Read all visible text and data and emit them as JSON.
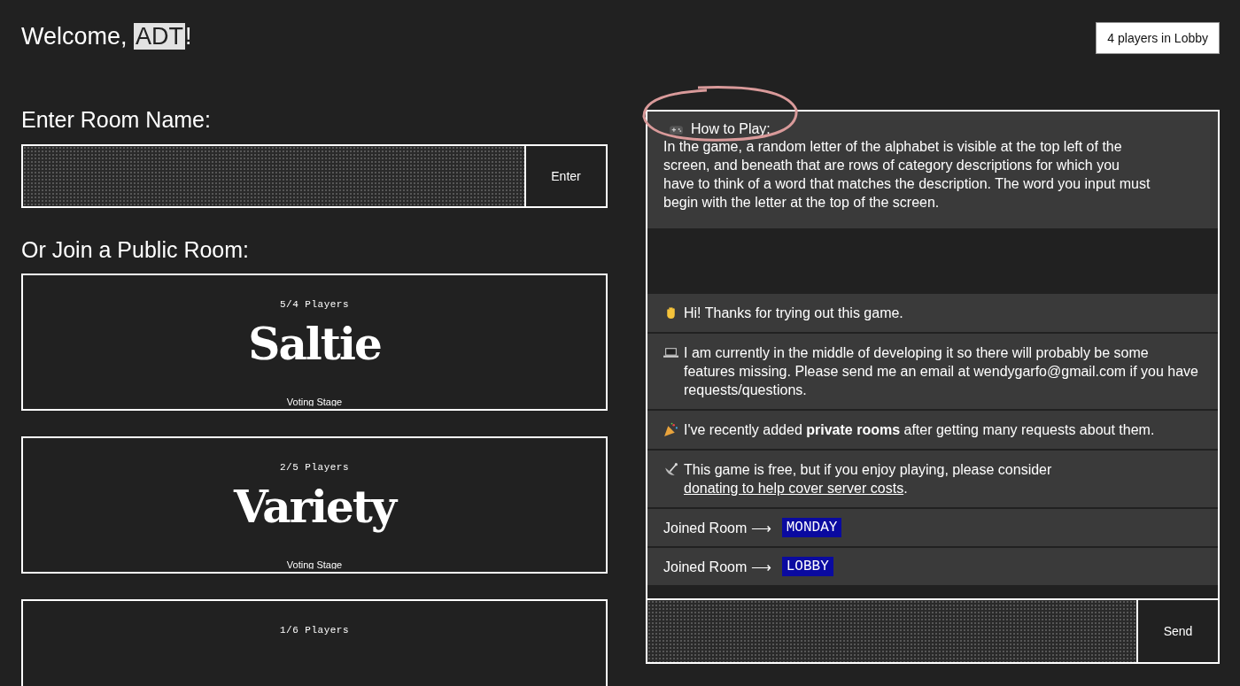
{
  "welcome": {
    "prefix": "Welcome,",
    "username": "ADT",
    "suffix": "!"
  },
  "lobby_count": "4 players in Lobby",
  "enter_room": {
    "heading": "Enter Room Name:",
    "button": "Enter"
  },
  "public_rooms": {
    "heading": "Or Join a Public Room:",
    "rooms": [
      {
        "players": "5/4 Players",
        "name": "Saltie",
        "stage": "Voting Stage"
      },
      {
        "players": "2/5 Players",
        "name": "Variety",
        "stage": "Voting Stage"
      },
      {
        "players": "1/6 Players"
      }
    ]
  },
  "chat": {
    "how_to_play": {
      "title": "How to Play:",
      "body": "In the game, a random letter of the alphabet is visible at the top left of the screen, and beneath that are rows of category descriptions for which you have to think of a word that matches the description. The word you input must begin with the letter at the top of the screen."
    },
    "messages": [
      {
        "kind": "notice",
        "text": "Hi! Thanks for trying out this game."
      },
      {
        "kind": "notice",
        "text": "I am currently in the middle of developing it so there will probably be some features missing. Please send me an email at wendygarfo@gmail.com if you have requests/questions."
      },
      {
        "kind": "notice",
        "text": "I've recently added **private rooms** after getting many requests about them."
      },
      {
        "kind": "notice",
        "text": "This game is free, but if you enjoy playing, please consider",
        "link": "donating to help cover server costs",
        "after_link": "."
      },
      {
        "kind": "joined",
        "text": "Joined Room",
        "arrow": "⟶",
        "room": "MONDAY"
      },
      {
        "kind": "joined",
        "text": "Joined Room",
        "arrow": "⟶",
        "room": "LOBBY"
      }
    ],
    "send_button": "Send"
  }
}
